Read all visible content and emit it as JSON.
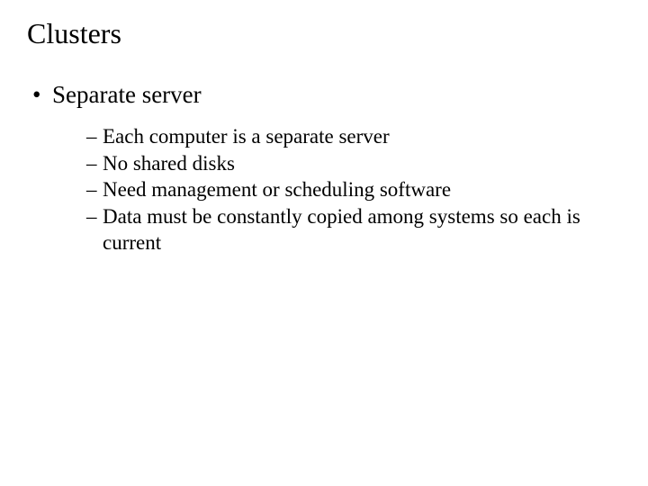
{
  "title": "Clusters",
  "bullets": [
    {
      "marker": "•",
      "text": "Separate server",
      "children": [
        {
          "marker": "–",
          "text": "Each computer is a separate server"
        },
        {
          "marker": "–",
          "text": "No shared disks"
        },
        {
          "marker": "–",
          "text": "Need management or scheduling software"
        },
        {
          "marker": "–",
          "text": "Data must be constantly copied among systems so each is current"
        }
      ]
    }
  ]
}
